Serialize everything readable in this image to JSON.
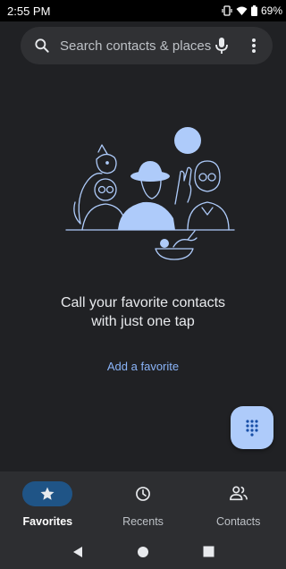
{
  "status_bar": {
    "time": "2:55 PM",
    "battery": "69%"
  },
  "search": {
    "placeholder": "Search contacts & places"
  },
  "empty_state": {
    "message": "Call your favorite contacts with just one tap",
    "action_label": "Add a favorite"
  },
  "bottom_nav": {
    "items": [
      {
        "label": "Favorites",
        "icon": "star-icon",
        "active": true
      },
      {
        "label": "Recents",
        "icon": "clock-icon",
        "active": false
      },
      {
        "label": "Contacts",
        "icon": "people-icon",
        "active": false
      }
    ]
  },
  "colors": {
    "background": "#202124",
    "accent": "#8ab4f8",
    "fab": "#aecbfa",
    "active_pill": "#1f5486"
  },
  "icons": [
    "search-icon",
    "mic-icon",
    "more-vert-icon",
    "dialpad-icon",
    "back-icon",
    "home-icon",
    "overview-icon"
  ]
}
